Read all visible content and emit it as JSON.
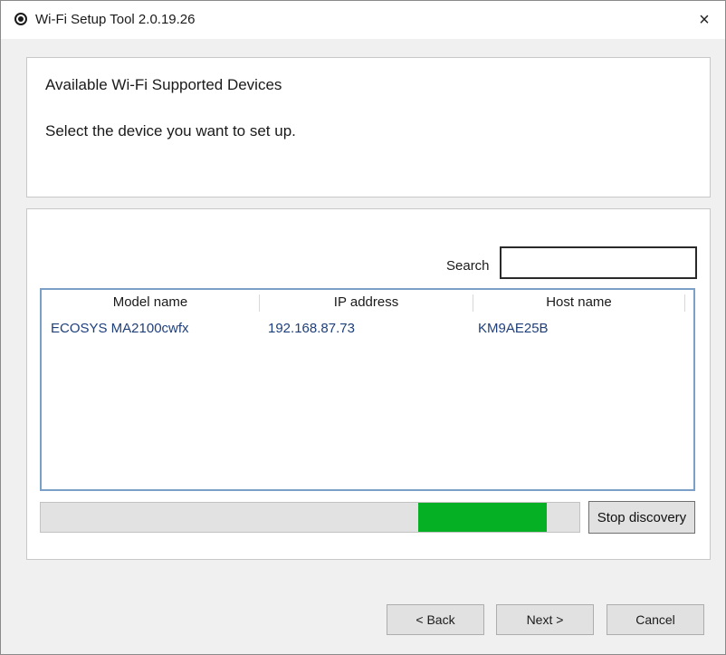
{
  "window": {
    "title": "Wi-Fi Setup Tool 2.0.19.26",
    "close_glyph": "×"
  },
  "header": {
    "title": "Available Wi-Fi Supported  Devices",
    "subtitle": "Select the device you want to set up."
  },
  "search": {
    "label": "Search",
    "value": ""
  },
  "table": {
    "columns": [
      "Model name",
      "IP address",
      "Host name"
    ],
    "rows": [
      {
        "model": "ECOSYS MA2100cwfx",
        "ip": "192.168.87.73",
        "host": "KM9AE25B"
      }
    ]
  },
  "progress": {
    "segment_start_pct": 70,
    "segment_end_pct": 94,
    "color": "#06b025"
  },
  "buttons": {
    "stop_discovery": "Stop discovery",
    "back": "< Back",
    "next": "Next >",
    "cancel": "Cancel"
  },
  "icons": {
    "app": "wifi-setup-app-icon",
    "close": "close-icon"
  }
}
